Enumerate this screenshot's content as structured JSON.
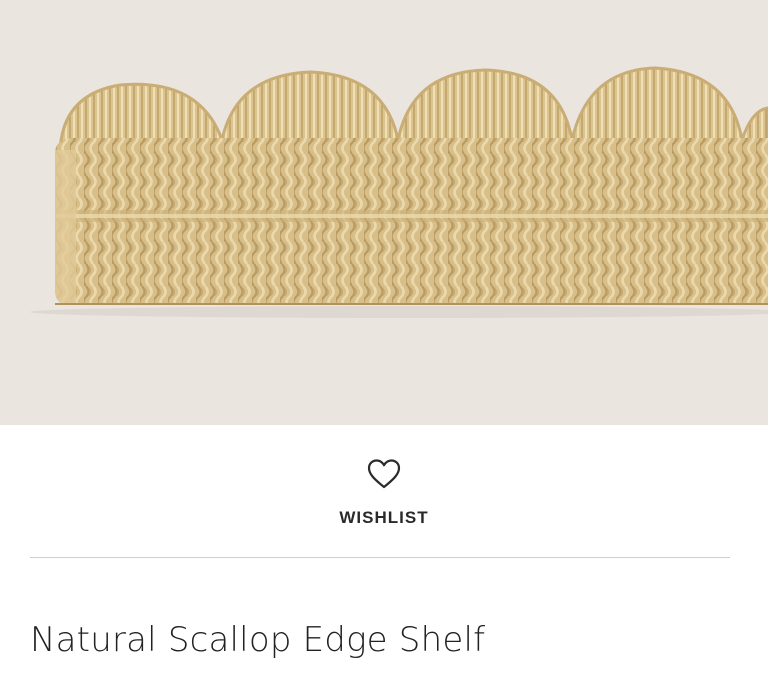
{
  "product": {
    "image_alt": "Natural Scallop Edge Shelf",
    "wishlist_label": "WISHLIST",
    "title": "Natural Scallop Edge Shelf"
  },
  "colors": {
    "image_background": "#ebe5e0",
    "weave_base": "#d8bf8a",
    "weave_highlight": "#ecd9ab",
    "weave_shadow": "#b89b62",
    "text": "#222222",
    "divider": "#cfcfcf"
  },
  "icons": {
    "wishlist": "heart-outline-icon"
  }
}
